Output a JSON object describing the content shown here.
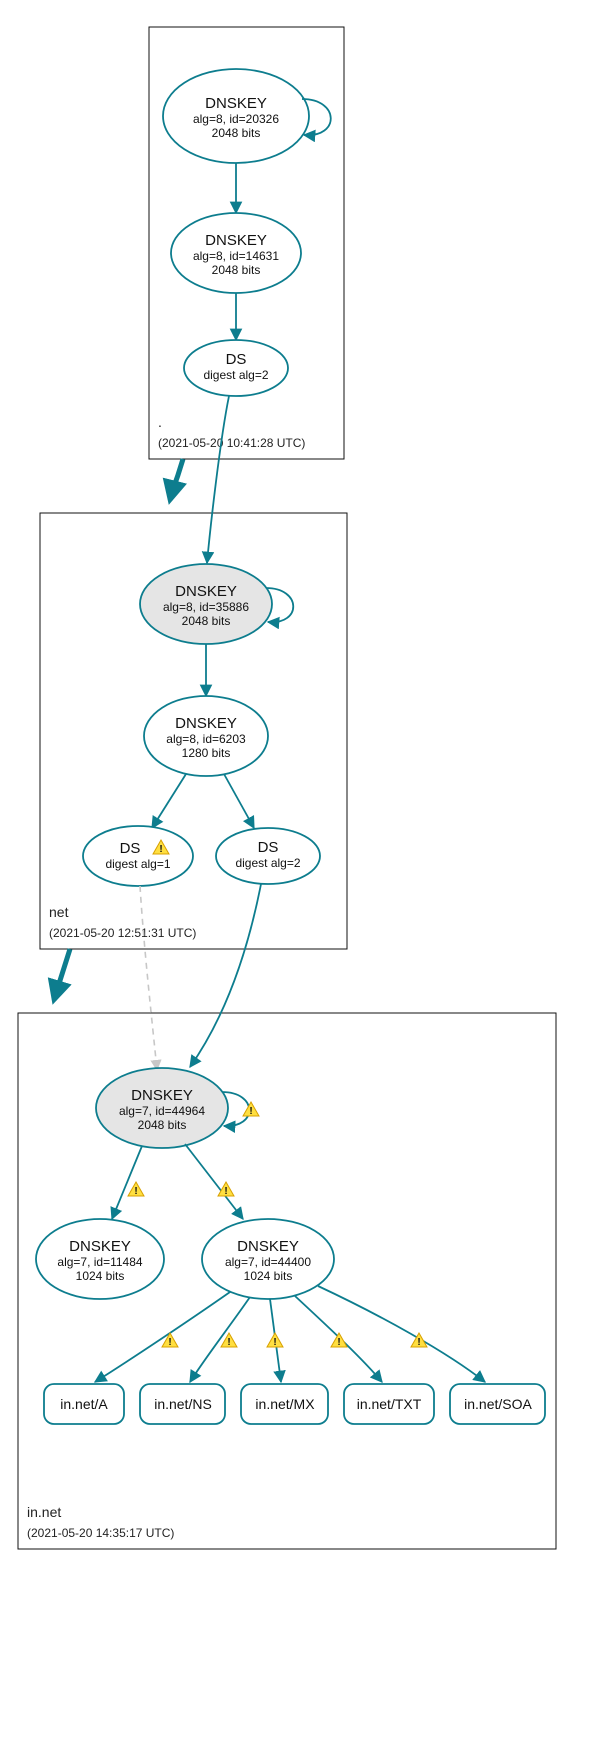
{
  "zones": {
    "root": {
      "name": ".",
      "timestamp": "(2021-05-20 10:41:28 UTC)"
    },
    "net": {
      "name": "net",
      "timestamp": "(2021-05-20 12:51:31 UTC)"
    },
    "innet": {
      "name": "in.net",
      "timestamp": "(2021-05-20 14:35:17 UTC)"
    }
  },
  "nodes": {
    "root_ksk": {
      "title": "DNSKEY",
      "line2": "alg=8, id=20326",
      "line3": "2048 bits"
    },
    "root_zsk": {
      "title": "DNSKEY",
      "line2": "alg=8, id=14631",
      "line3": "2048 bits"
    },
    "root_ds": {
      "title": "DS",
      "line2": "digest alg=2"
    },
    "net_ksk": {
      "title": "DNSKEY",
      "line2": "alg=8, id=35886",
      "line3": "2048 bits"
    },
    "net_zsk": {
      "title": "DNSKEY",
      "line2": "alg=8, id=6203",
      "line3": "1280 bits"
    },
    "net_ds1": {
      "title": "DS",
      "line2": "digest alg=1"
    },
    "net_ds2": {
      "title": "DS",
      "line2": "digest alg=2"
    },
    "innet_ksk": {
      "title": "DNSKEY",
      "line2": "alg=7, id=44964",
      "line3": "2048 bits"
    },
    "innet_zsk1": {
      "title": "DNSKEY",
      "line2": "alg=7, id=11484",
      "line3": "1024 bits"
    },
    "innet_zsk2": {
      "title": "DNSKEY",
      "line2": "alg=7, id=44400",
      "line3": "1024 bits"
    }
  },
  "rrsets": {
    "a": "in.net/A",
    "ns": "in.net/NS",
    "mx": "in.net/MX",
    "txt": "in.net/TXT",
    "soa": "in.net/SOA"
  }
}
